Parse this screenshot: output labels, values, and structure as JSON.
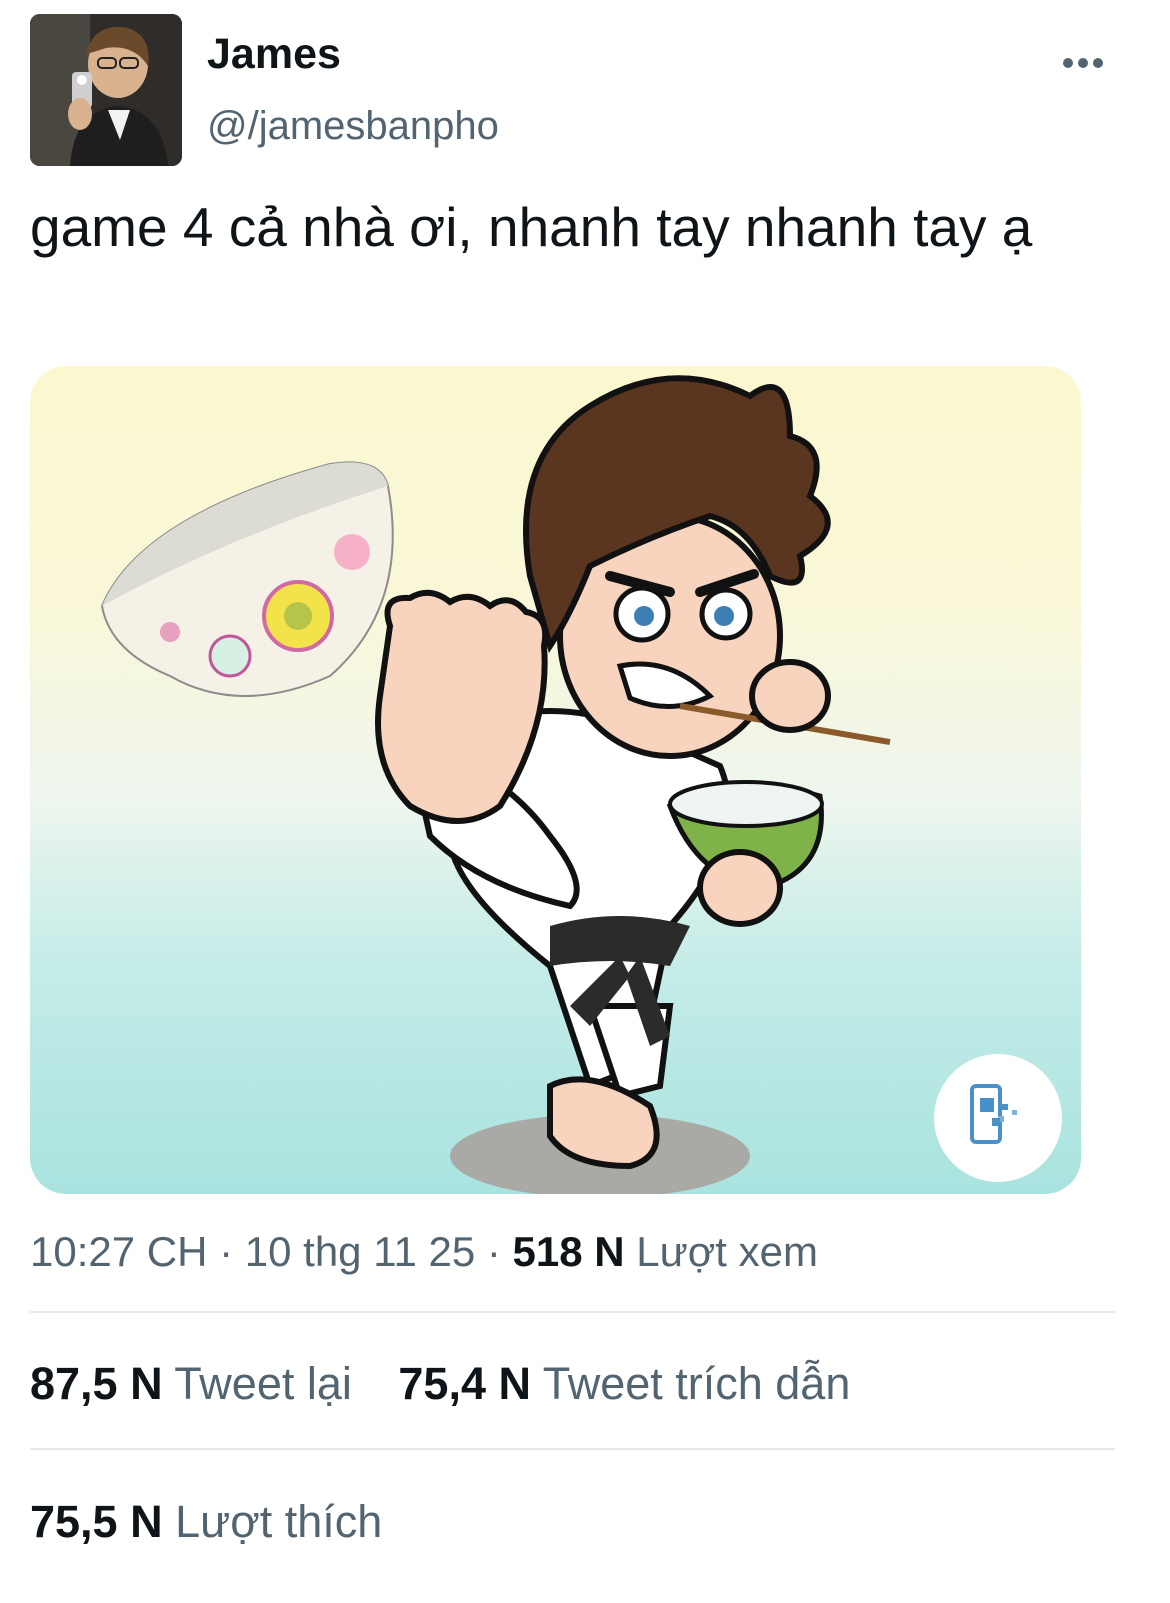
{
  "tweet": {
    "author": {
      "name": "James",
      "handle": "@/jamesbanpho"
    },
    "more_icon": "ellipsis-icon",
    "text": "game 4 cả nhà ơi, nhanh tay nhanh tay ạ",
    "media": {
      "badge_icon": "phone-share-icon"
    },
    "meta": {
      "time": "10:27 CH",
      "date": "10 thg 11 25",
      "views_count": "518 N",
      "views_label": "Lượt xem"
    },
    "stats": {
      "retweets_count": "87,5 N",
      "retweets_label": "Tweet lại",
      "quotes_count": "75,4 N",
      "quotes_label": "Tweet trích dẫn",
      "likes_count": "75,5 N",
      "likes_label": "Lượt thích"
    }
  }
}
